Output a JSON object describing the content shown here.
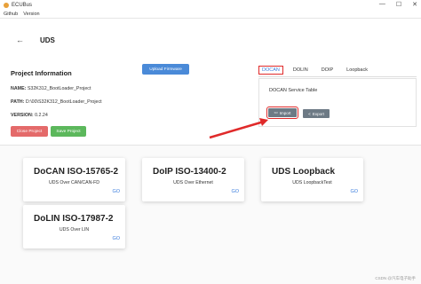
{
  "titlebar": {
    "app_name": "ECUBus",
    "minimize": "—",
    "maximize": "☐",
    "close": "✕"
  },
  "menu": {
    "items": [
      "Github",
      "Version"
    ]
  },
  "header": {
    "back": "←",
    "title": "UDS"
  },
  "project": {
    "title": "Project Information",
    "name_label": "NAME:",
    "name_value": "S32K312_BootLoader_Project",
    "path_label": "PATH:",
    "path_value": "D:\\00\\S32K312_BootLoader_Project",
    "version_label": "VERSION:",
    "version_value": "0.2.24",
    "close_label": "Close Project",
    "save_label": "Save Project",
    "upload_label": "Upload Firmware"
  },
  "tabs": [
    "DOCAN",
    "DOLIN",
    "DOIP",
    "Loopback"
  ],
  "service": {
    "title": "DOCAN Service Table",
    "import_label": "Import",
    "export_label": "Export"
  },
  "cards": [
    {
      "title": "DoCAN ISO-15765-2",
      "subtitle": "UDS Over CAN/CAN-FD",
      "go": "GO"
    },
    {
      "title": "DoIP ISO-13400-2",
      "subtitle": "UDS Over Ethernet",
      "go": "GO"
    },
    {
      "title": "UDS Loopback",
      "subtitle": "UDS LoopbackTest",
      "go": "GO"
    },
    {
      "title": "DoLIN ISO-17987-2",
      "subtitle": "UDS Over LIN",
      "go": "GO"
    }
  ],
  "watermark": "CSDN @汽车电子助手",
  "colors": {
    "accent": "#3b7ddd",
    "annotation": "#e02a2a",
    "danger": "#e46a6a",
    "success": "#5cb85c"
  }
}
